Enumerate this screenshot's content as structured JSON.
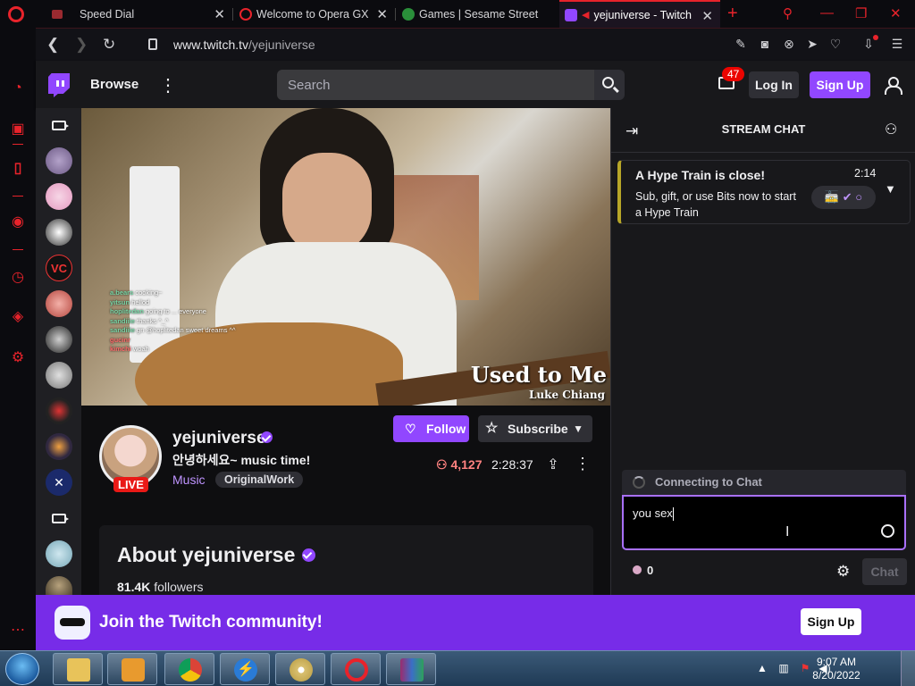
{
  "browser": {
    "tabs": [
      {
        "label": "Speed Dial",
        "active": false,
        "icon": "speed-dial-icon"
      },
      {
        "label": "Welcome to Opera GX",
        "active": false,
        "icon": "opera-icon"
      },
      {
        "label": "Games | Sesame Street |",
        "active": false,
        "icon": "sesame-icon"
      },
      {
        "label": "yejuniverse - Twitch",
        "active": true,
        "icon": "twitch-icon"
      }
    ],
    "url_host": "www.twitch.tv",
    "url_path": "/yejuniverse",
    "accent": "#e8232b"
  },
  "twitch": {
    "nav": {
      "browse": "Browse",
      "search_placeholder": "Search",
      "notif_count": "47",
      "login": "Log In",
      "signup": "Sign Up"
    },
    "stream": {
      "channel": "yejuniverse",
      "title": "안녕하세요~ music time!",
      "category": "Music",
      "tag": "OriginalWork",
      "live_label": "LIVE",
      "follow": "Follow",
      "subscribe": "Subscribe",
      "viewers": "4,127",
      "uptime": "2:28:37",
      "song_title": "Used to Me",
      "song_artist": "Luke Chiang",
      "overlay_chat": [
        {
          "user": "a.bears",
          "text": "cooking~"
        },
        {
          "user": "yitsun",
          "text": "hellod"
        },
        {
          "user": "hoplitedan",
          "text": "going to ... everyone"
        },
        {
          "user": "sandiiie",
          "text": "thanks ^_^"
        },
        {
          "user": "sandiiie",
          "text": "gn @hoplitedan sweet dreams ^^"
        },
        {
          "user": "gucinr",
          "text": ""
        },
        {
          "user": "kimchi",
          "text": "woah"
        }
      ]
    },
    "about": {
      "title": "About yejuniverse",
      "followers_count": "81.4K",
      "followers_label": "followers"
    },
    "chat": {
      "title": "STREAM CHAT",
      "hype_title": "A Hype Train is close!",
      "hype_time": "2:14",
      "hype_sub": "Sub, gift, or use Bits now to start a Hype Train",
      "connecting": "Connecting to Chat",
      "input_value": "you sex",
      "points": "0",
      "send": "Chat"
    },
    "join": {
      "text": "Join the Twitch community!",
      "signup": "Sign Up"
    },
    "brand_color": "#9147ff",
    "live_color": "#e91916"
  },
  "taskbar": {
    "time": "9:07 AM",
    "date": "8/20/2022",
    "apps": [
      "file-explorer-icon",
      "media-player-icon",
      "chrome-icon",
      "bolt-app-icon",
      "disc-icon",
      "opera-icon",
      "archive-icon"
    ]
  }
}
